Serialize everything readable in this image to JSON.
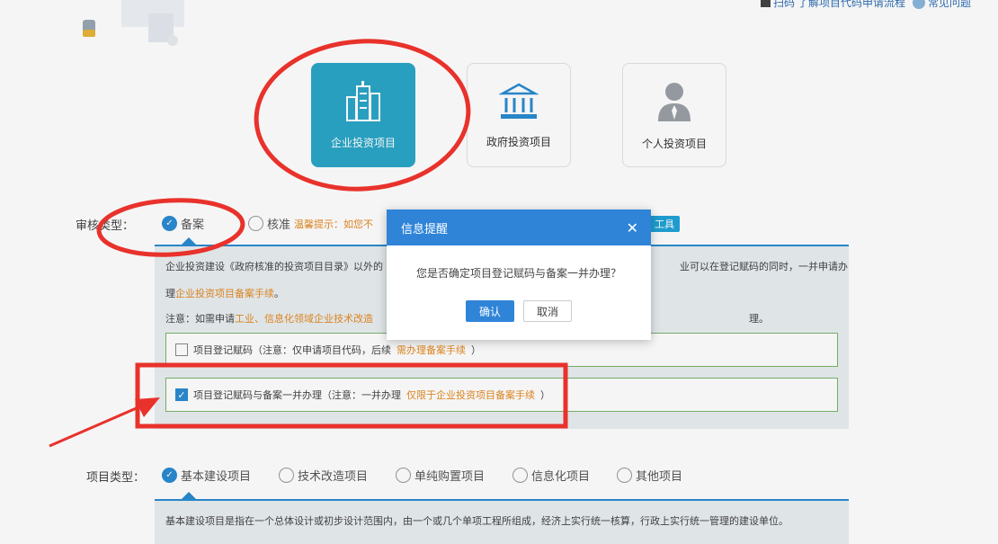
{
  "topbar": {
    "scan_text": "扫码",
    "flow_text": "了解项目代码申请流程",
    "faq_text": "常见问题"
  },
  "cards": [
    {
      "label": "企业投资项目",
      "icon": "enterprise-building-icon",
      "active": true
    },
    {
      "label": "政府投资项目",
      "icon": "government-building-icon",
      "active": false
    },
    {
      "label": "个人投资项目",
      "icon": "person-icon",
      "active": false
    }
  ],
  "review_type": {
    "label": "审核类型：",
    "options": [
      {
        "label": "备案",
        "selected": true
      },
      {
        "label": "核准",
        "selected": false
      }
    ],
    "warning_prefix": "温馨提示：如您不",
    "tool_button": "工具"
  },
  "notice": {
    "line1_start": "企业投资建设《政府核准的投资项目目录》以外的",
    "line1_end": "业可以在登记赋码的同时，一并申请办",
    "line2_plain": "理",
    "line2_link": "企业投资项目备案手续",
    "line2_end": "。",
    "line3_start": "注意：如需申请",
    "line3_link1": "工业、",
    "line3_link2": "信息化领域企业技术改造",
    "line3_end": "理。"
  },
  "options": [
    {
      "text": "项目登记赋码（注意：仅申请项目代码，后续",
      "link": "需办理备案手续",
      "tail": "）",
      "checked": false
    },
    {
      "text": "项目登记赋码与备案一并办理（注意：一并办理",
      "link": "仅限于企业投资项目备案手续",
      "tail": "）",
      "checked": true
    }
  ],
  "project_type": {
    "label": "项目类型：",
    "options": [
      {
        "label": "基本建设项目",
        "selected": true
      },
      {
        "label": "技术改造项目",
        "selected": false
      },
      {
        "label": "单纯购置项目",
        "selected": false
      },
      {
        "label": "信息化项目",
        "selected": false
      },
      {
        "label": "其他项目",
        "selected": false
      }
    ],
    "description": "基本建设项目是指在一个总体设计或初步设计范围内，由一个或几个单项工程所组成，经济上实行统一核算，行政上实行统一管理的建设单位。"
  },
  "modal": {
    "title": "信息提醒",
    "message": "您是否确定项目登记赋码与备案一并办理？",
    "confirm": "确认",
    "cancel": "取消"
  },
  "colors": {
    "primary": "#2f84d8",
    "accent_teal": "#2ba6c8",
    "warning_orange": "#e48a22",
    "annotation_red": "#e8322b"
  }
}
